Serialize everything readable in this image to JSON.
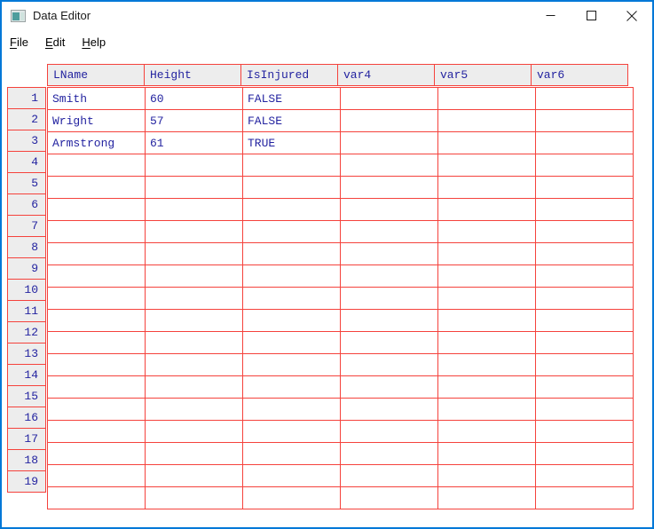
{
  "window": {
    "title": "Data Editor"
  },
  "menu": {
    "items": [
      {
        "mnemonic": "F",
        "rest": "ile"
      },
      {
        "mnemonic": "E",
        "rest": "dit"
      },
      {
        "mnemonic": "H",
        "rest": "elp"
      }
    ]
  },
  "grid": {
    "columns": [
      "LName",
      "Height",
      "IsInjured",
      "var4",
      "var5",
      "var6"
    ],
    "rows": [
      {
        "n": "1",
        "cells": [
          "Smith",
          "60",
          "FALSE",
          "",
          "",
          ""
        ]
      },
      {
        "n": "2",
        "cells": [
          "Wright",
          "57",
          "FALSE",
          "",
          "",
          ""
        ]
      },
      {
        "n": "3",
        "cells": [
          "Armstrong",
          "61",
          "TRUE",
          "",
          "",
          ""
        ]
      },
      {
        "n": "4",
        "cells": [
          "",
          "",
          "",
          "",
          "",
          ""
        ]
      },
      {
        "n": "5",
        "cells": [
          "",
          "",
          "",
          "",
          "",
          ""
        ]
      },
      {
        "n": "6",
        "cells": [
          "",
          "",
          "",
          "",
          "",
          ""
        ]
      },
      {
        "n": "7",
        "cells": [
          "",
          "",
          "",
          "",
          "",
          ""
        ]
      },
      {
        "n": "8",
        "cells": [
          "",
          "",
          "",
          "",
          "",
          ""
        ]
      },
      {
        "n": "9",
        "cells": [
          "",
          "",
          "",
          "",
          "",
          ""
        ]
      },
      {
        "n": "10",
        "cells": [
          "",
          "",
          "",
          "",
          "",
          ""
        ]
      },
      {
        "n": "11",
        "cells": [
          "",
          "",
          "",
          "",
          "",
          ""
        ]
      },
      {
        "n": "12",
        "cells": [
          "",
          "",
          "",
          "",
          "",
          ""
        ]
      },
      {
        "n": "13",
        "cells": [
          "",
          "",
          "",
          "",
          "",
          ""
        ]
      },
      {
        "n": "14",
        "cells": [
          "",
          "",
          "",
          "",
          "",
          ""
        ]
      },
      {
        "n": "15",
        "cells": [
          "",
          "",
          "",
          "",
          "",
          ""
        ]
      },
      {
        "n": "16",
        "cells": [
          "",
          "",
          "",
          "",
          "",
          ""
        ]
      },
      {
        "n": "17",
        "cells": [
          "",
          "",
          "",
          "",
          "",
          ""
        ]
      },
      {
        "n": "18",
        "cells": [
          "",
          "",
          "",
          "",
          "",
          ""
        ]
      },
      {
        "n": "19",
        "cells": [
          "",
          "",
          "",
          "",
          "",
          ""
        ]
      }
    ]
  },
  "colors": {
    "grid_line": "#f5423c",
    "cell_text": "#2323a0",
    "header_bg": "#ededed",
    "window_border": "#0078d7"
  }
}
